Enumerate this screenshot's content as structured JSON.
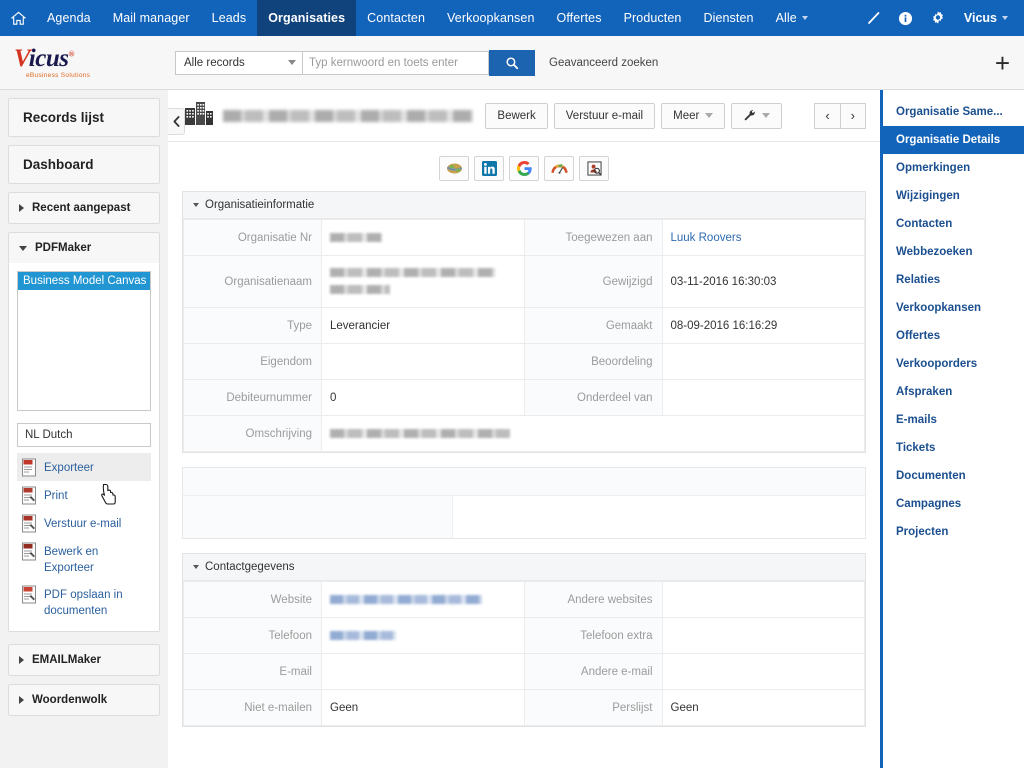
{
  "topnav": {
    "home_icon": "home-icon",
    "items": [
      {
        "label": "Agenda",
        "active": false
      },
      {
        "label": "Mail manager",
        "active": false
      },
      {
        "label": "Leads",
        "active": false
      },
      {
        "label": "Organisaties",
        "active": true
      },
      {
        "label": "Contacten",
        "active": false
      },
      {
        "label": "Verkoopkansen",
        "active": false
      },
      {
        "label": "Offertes",
        "active": false
      },
      {
        "label": "Producten",
        "active": false
      },
      {
        "label": "Diensten",
        "active": false
      },
      {
        "label": "Alle",
        "active": false,
        "has_caret": true
      }
    ],
    "right_icons": [
      "pencil-icon",
      "info-icon",
      "gear-icon"
    ],
    "user_label": "Vicus",
    "bg_color": "#1263ba",
    "active_color": "#10427c"
  },
  "searchbar": {
    "logo_main": "icus",
    "logo_v": "V",
    "logo_reg": "®",
    "logo_sub": "eBusiness Solutions",
    "record_scope": "Alle records",
    "keyword_placeholder": "Typ kernwoord en toets enter",
    "keyword_value": "",
    "search_icon": "search-icon",
    "advanced_search": "Geavanceerd zoeken",
    "add_label": "+"
  },
  "leftbar": {
    "records_list": "Records lijst",
    "dashboard": "Dashboard",
    "recent": "Recent aangepast",
    "pdfmaker": "PDFMaker",
    "pdfmaker_options": [
      "Business Model Canvas (A"
    ],
    "language_value": "NL Dutch",
    "actions": [
      {
        "label": "Exporteer",
        "icon": "pdf-export-icon",
        "hover": true
      },
      {
        "label": "Print",
        "icon": "pdf-print-icon",
        "hover": false
      },
      {
        "label": "Verstuur e-mail",
        "icon": "pdf-mail-icon",
        "hover": false
      },
      {
        "label": "Bewerk en Exporteer",
        "icon": "pdf-edit-icon",
        "hover": false
      },
      {
        "label": "PDF opslaan in documenten",
        "icon": "pdf-save-icon",
        "hover": false
      }
    ],
    "emailmaker": "EMAILMaker",
    "woordenwolk": "Woordenwolk",
    "collapse_icon": "chevron-left-icon"
  },
  "record": {
    "title_redacted": true,
    "org_icon": "building-icon",
    "buttons": [
      {
        "label": "Bewerk",
        "name": "edit-button"
      },
      {
        "label": "Verstuur e-mail",
        "name": "send-email-button"
      },
      {
        "label": "Meer",
        "name": "more-button",
        "caret": true
      },
      {
        "label": "",
        "name": "tools-button",
        "icon": "wrench-icon",
        "caret": true
      }
    ],
    "prev_label": "‹",
    "next_label": "›",
    "link_icons": [
      "globe-icon",
      "linkedin-icon",
      "google-icon",
      "gauge-icon",
      "person-search-icon"
    ]
  },
  "org_info": {
    "title": "Organisatieinformatie",
    "rows": [
      {
        "l1": "Organisatie Nr",
        "v1": "",
        "v1_redacted": true,
        "v1_w": 52,
        "l2": "Toegewezen aan",
        "v2": "Luuk Roovers",
        "v2_link": true
      },
      {
        "l1": "Organisatienaam",
        "v1": "",
        "v1_redacted": true,
        "v1_w": 165,
        "v1_redacted2_w": 60,
        "l2": "Gewijzigd",
        "v2": "03-11-2016 16:30:03"
      },
      {
        "l1": "Type",
        "v1": "Leverancier",
        "l2": "Gemaakt",
        "v2": "08-09-2016 16:16:29"
      },
      {
        "l1": "Eigendom",
        "v1": "",
        "l2": "Beoordeling",
        "v2": ""
      },
      {
        "l1": "Debiteurnummer",
        "v1": "0",
        "l2": "Onderdeel van",
        "v2": ""
      }
    ],
    "full_row": {
      "label": "Omschrijving",
      "value": "",
      "redacted": true,
      "w": 180
    }
  },
  "contact_info": {
    "title": "Contactgegevens",
    "rows": [
      {
        "l1": "Website",
        "v1": "",
        "v1_redacted": true,
        "v1_blue": true,
        "v1_w": 152,
        "l2": "Andere websites",
        "v2": ""
      },
      {
        "l1": "Telefoon",
        "v1": "",
        "v1_redacted": true,
        "v1_blue": true,
        "v1_w": 66,
        "l2": "Telefoon extra",
        "v2": ""
      },
      {
        "l1": "E-mail",
        "v1": "",
        "l2": "Andere e-mail",
        "v2": ""
      },
      {
        "l1": "Niet e-mailen",
        "v1": "Geen",
        "l2": "Perslijst",
        "v2": "Geen"
      }
    ]
  },
  "rightnav": {
    "items": [
      {
        "label": "Organisatie Same...",
        "active": false
      },
      {
        "label": "Organisatie Details",
        "active": true
      },
      {
        "label": "Opmerkingen",
        "active": false
      },
      {
        "label": "Wijzigingen",
        "active": false
      },
      {
        "label": "Contacten",
        "active": false
      },
      {
        "label": "Webbezoeken",
        "active": false
      },
      {
        "label": "Relaties",
        "active": false
      },
      {
        "label": "Verkoopkansen",
        "active": false
      },
      {
        "label": "Offertes",
        "active": false
      },
      {
        "label": "Verkooporders",
        "active": false
      },
      {
        "label": "Afspraken",
        "active": false
      },
      {
        "label": "E-mails",
        "active": false
      },
      {
        "label": "Tickets",
        "active": false
      },
      {
        "label": "Documenten",
        "active": false
      },
      {
        "label": "Campagnes",
        "active": false
      },
      {
        "label": "Projecten",
        "active": false
      }
    ],
    "accent_color": "#1263ba",
    "link_color": "#1b4f8f"
  }
}
